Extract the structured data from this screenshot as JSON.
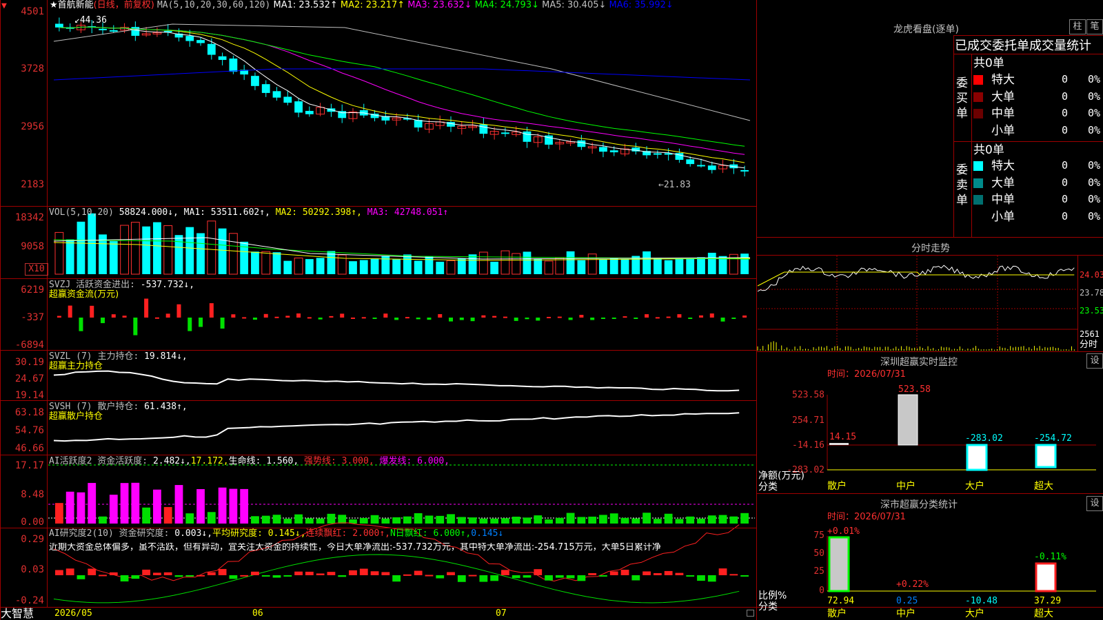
{
  "stock": {
    "name": "首航新能",
    "mode": "(日线，前复权)",
    "ma_header": "MA(5,10,20,30,60,120)",
    "ma": [
      {
        "label": "MA1:",
        "value": "23.532↑",
        "color": "#ffffff"
      },
      {
        "label": "MA2:",
        "value": "23.217↑",
        "color": "#ffff00"
      },
      {
        "label": "MA3:",
        "value": "23.632↓",
        "color": "#ff00ff"
      },
      {
        "label": "MA4:",
        "value": "24.793↓",
        "color": "#00ff00"
      },
      {
        "label": "MA5:",
        "value": "30.405↓",
        "color": "#c0c0c0"
      },
      {
        "label": "MA6:",
        "value": "35.992↓",
        "color": "#0000ff"
      }
    ],
    "high_mark": "44.36",
    "low_mark": "←21.83",
    "price_axis": [
      "4501",
      "3728",
      "2956",
      "2183"
    ]
  },
  "volume": {
    "header": "VOL(5,10,20)",
    "value": "58824.000↓,",
    "ma": [
      {
        "label": "MA1:",
        "value": "53511.602↑,",
        "color": "#ffffff"
      },
      {
        "label": "MA2:",
        "value": "50292.398↑,",
        "color": "#ffff00"
      },
      {
        "label": "MA3:",
        "value": "42748.051↑",
        "color": "#ff00ff"
      }
    ],
    "axis": [
      "18342",
      "9058"
    ],
    "unit": "X10"
  },
  "svzj": {
    "header": "SVZJ  活跃资金进出:",
    "value": "-537.732↓,",
    "subtitle": "超赢资金流(万元)",
    "axis": [
      "6219",
      "-337",
      "-6894"
    ]
  },
  "svzl": {
    "header": "SVZL (7) 主力持仓:",
    "value": "19.814↓,",
    "subtitle": "超赢主力持仓",
    "axis": [
      "30.19",
      "24.67",
      "19.14"
    ]
  },
  "svsh": {
    "header": "SVSH (7) 散户持仓:",
    "value": "61.438↑,",
    "subtitle": "超赢散户持仓",
    "axis": [
      "63.18",
      "54.76",
      "46.66"
    ]
  },
  "ai_active": {
    "header": "AI活跃度2 资金活跃度:",
    "v1": "2.482↓,",
    "v2": "17.172,",
    "life_label": "生命线:",
    "life_value": "1.560,",
    "strong_label": "强势线:",
    "strong_value": "3.000,",
    "burst_label": "爆发线:",
    "burst_value": "6.000,",
    "axis": [
      "17.17",
      "8.48",
      "0.00"
    ]
  },
  "ai_research": {
    "header": "AI研究度2(10) 资金研究度:",
    "v1": "0.003↓,",
    "avg_label": "平均研究度:",
    "avg_value": "0.145↓,",
    "cont_label": "连续飘红:",
    "cont_value": "2.000↑,",
    "n_label": "N日飘红:",
    "n_value": "6.000↑,",
    "last_value": "0.145↓",
    "comment": "近期大资金总体偏多，虽不活跃，但有异动，宜关注大资金的持续性，今日大单净流出:-537.732万元，其中特大单净流出:-254.715万元，大单5日累计净",
    "axis": [
      "0.29",
      "0.03",
      "-0.24"
    ]
  },
  "bottom": {
    "brand": "大智慧",
    "dates": [
      "2026/05",
      "06",
      "07"
    ]
  },
  "lhb": {
    "title": "龙虎看盘(逐单)",
    "btn_bar": "柱",
    "btn_pen": "笔",
    "tabs": "已成交委托单成交量统计",
    "buy_label": "委买单",
    "sell_label": "委卖单",
    "buy_total": "共0单",
    "sell_total": "共0单",
    "buy_rows": [
      {
        "name": "特大",
        "count": "0",
        "pct": "0%",
        "color": "#ff0000"
      },
      {
        "name": "大单",
        "count": "0",
        "pct": "0%",
        "color": "#8b0000"
      },
      {
        "name": "中单",
        "count": "0",
        "pct": "0%",
        "color": "#6b0000"
      },
      {
        "name": "小单",
        "count": "0",
        "pct": "0%",
        "color": ""
      }
    ],
    "sell_rows": [
      {
        "name": "特大",
        "count": "0",
        "pct": "0%",
        "color": "#00ffff"
      },
      {
        "name": "大单",
        "count": "0",
        "pct": "0%",
        "color": "#008b8b"
      },
      {
        "name": "中单",
        "count": "0",
        "pct": "0%",
        "color": "#007070"
      },
      {
        "name": "小单",
        "count": "0",
        "pct": "0%",
        "color": ""
      }
    ]
  },
  "intraday": {
    "title": "分时走势",
    "axis": [
      "24.03",
      "23.78",
      "23.53",
      "2561"
    ],
    "unit": "分时"
  },
  "sz_monitor": {
    "title": "深圳超赢实时监控",
    "btn": "设",
    "time": "时间：2026/07/31",
    "axis": [
      "523.58",
      "254.71",
      "-14.16",
      "-283.02"
    ],
    "ylabel": "净额(万元)",
    "xlabel": "分类",
    "categories": [
      "散户",
      "中户",
      "大户",
      "超大"
    ],
    "values": [
      "14.15",
      "523.58",
      "-283.02",
      "-254.72"
    ]
  },
  "sz_class": {
    "title": "深市超赢分类统计",
    "btn": "设",
    "time": "时间：2026/07/31",
    "axis": [
      "75",
      "50",
      "25",
      "0"
    ],
    "ylabel": "比例%",
    "xlabel": "分类",
    "categories": [
      "散户",
      "中户",
      "大户",
      "超大"
    ],
    "top_labels": [
      "+0.01%",
      "+0.22%",
      "",
      "-0.11%"
    ],
    "bottom_values": [
      "72.94",
      "0.25",
      "-10.48",
      "37.29"
    ]
  }
}
